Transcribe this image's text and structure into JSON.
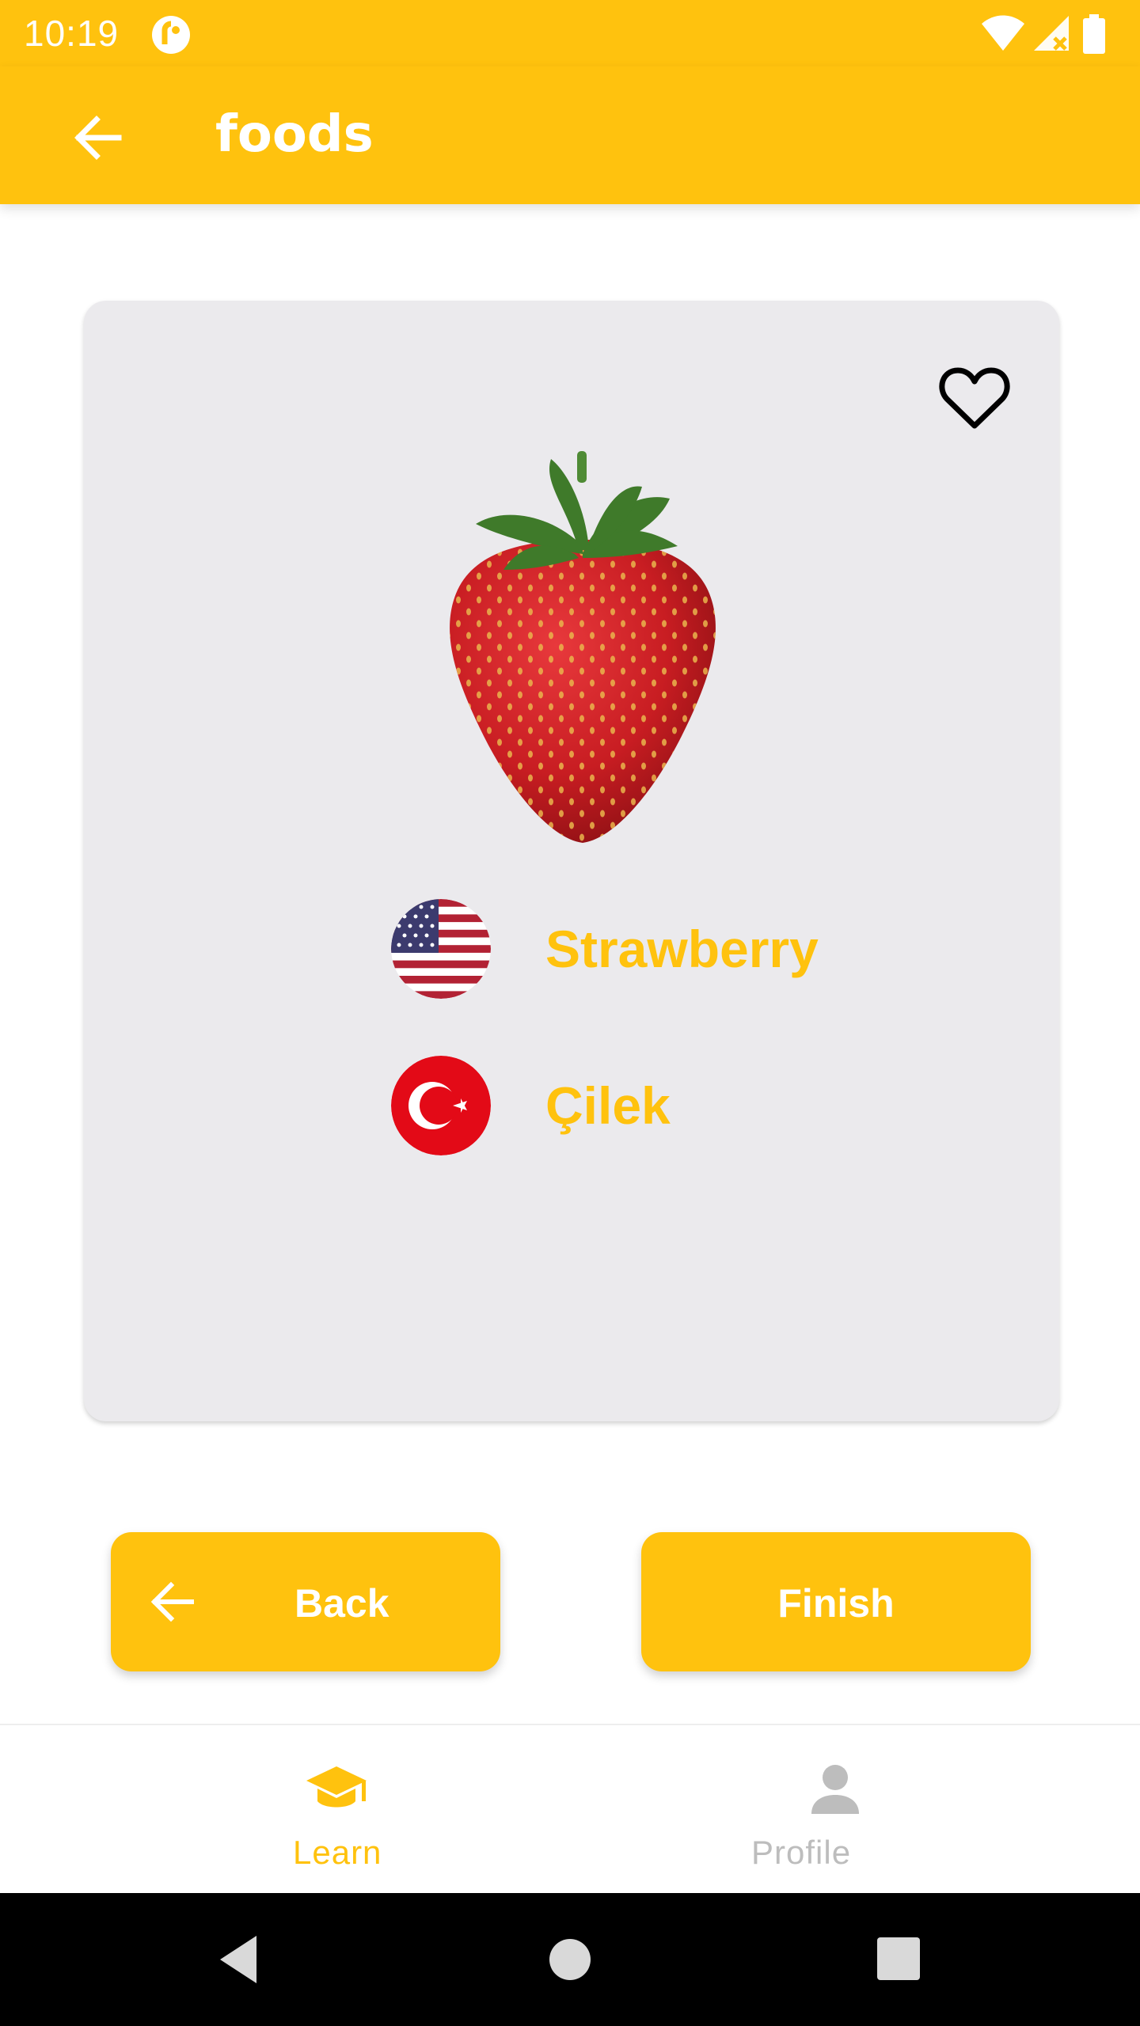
{
  "status_bar": {
    "time": "10:19",
    "icons": [
      "app-notification-icon",
      "wifi-icon",
      "cell-signal-icon",
      "battery-icon"
    ]
  },
  "toolbar": {
    "title": "foods",
    "back_icon": "arrow-back-icon"
  },
  "card": {
    "favorite_icon": "heart-outline-icon",
    "image": "strawberry",
    "translations": [
      {
        "flag": "us-flag",
        "word": "Strawberry"
      },
      {
        "flag": "turkey-flag",
        "word": "Çilek"
      }
    ]
  },
  "buttons": {
    "back_label": "Back",
    "finish_label": "Finish"
  },
  "bottom_nav": {
    "items": [
      {
        "label": "Learn",
        "icon": "graduation-cap-icon",
        "active": true
      },
      {
        "label": "Profile",
        "icon": "person-icon",
        "active": false
      }
    ]
  },
  "colors": {
    "accent": "#FFC20E",
    "card_background": "#EBEAED",
    "inactive": "#BDBDBD"
  }
}
